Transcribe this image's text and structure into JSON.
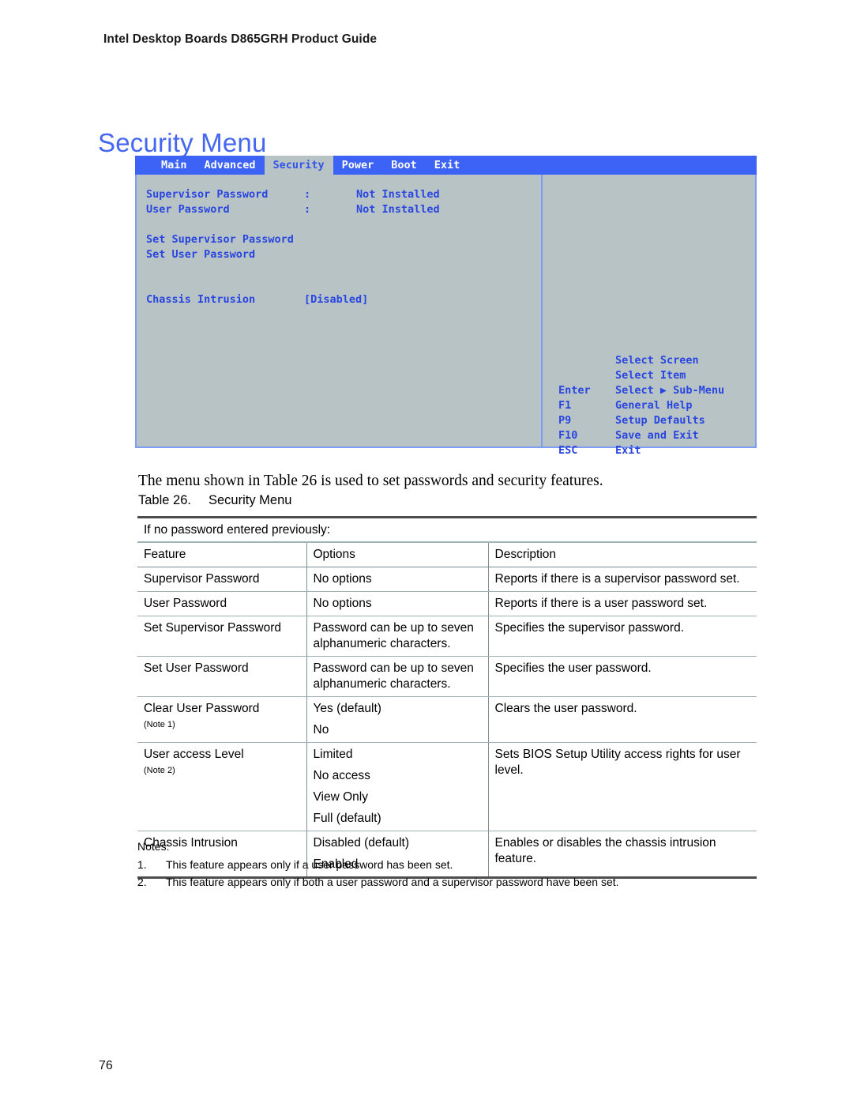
{
  "header": {
    "running_head": "Intel Desktop Boards D865GRH Product Guide"
  },
  "page_title": "Security Menu",
  "bios": {
    "tabs": [
      {
        "label": "Main",
        "active": false
      },
      {
        "label": "Advanced",
        "active": false
      },
      {
        "label": "Security",
        "active": true
      },
      {
        "label": "Power",
        "active": false
      },
      {
        "label": "Boot",
        "active": false
      },
      {
        "label": "Exit",
        "active": false
      }
    ],
    "status_rows": [
      {
        "label": "Supervisor Password",
        "colon": ":",
        "value": "Not Installed"
      },
      {
        "label": "User Password",
        "colon": ":",
        "value": "Not Installed"
      }
    ],
    "actions": [
      "Set Supervisor Password",
      "Set User Password"
    ],
    "setting": {
      "label": "Chassis Intrusion",
      "value": "[Disabled]"
    },
    "help": [
      {
        "key": "",
        "desc": "Select Screen"
      },
      {
        "key": "",
        "desc": "Select Item"
      },
      {
        "key": "Enter",
        "desc": "Select ▶ Sub-Menu"
      },
      {
        "key": "F1",
        "desc": "General Help"
      },
      {
        "key": "P9",
        "desc": "Setup Defaults"
      },
      {
        "key": "F10",
        "desc": "Save and Exit"
      },
      {
        "key": "ESC",
        "desc": "Exit"
      }
    ],
    "colors": {
      "menubar": "#3c63f5",
      "panel": "#b7c3c5",
      "text": "#2a46e0",
      "border": "#7e9cf0"
    }
  },
  "body_paragraph": "The menu shown in Table 26 is used to set passwords and security features.",
  "table_caption": {
    "number": "Table 26.",
    "title": "Security Menu"
  },
  "table": {
    "banner": "If no password entered previously:",
    "headers": [
      "Feature",
      "Options",
      "Description"
    ],
    "rows": [
      {
        "feature": "Supervisor Password",
        "note": "",
        "options": [
          "No options"
        ],
        "description": [
          "Reports if there is a supervisor password set."
        ]
      },
      {
        "feature": "User Password",
        "note": "",
        "options": [
          "No options"
        ],
        "description": [
          "Reports if there is a user password set."
        ]
      },
      {
        "feature": "Set Supervisor Password",
        "note": "",
        "options": [
          "Password can be up to seven alphanumeric characters."
        ],
        "description": [
          "Specifies the supervisor password."
        ]
      },
      {
        "feature": "Set User Password",
        "note": "",
        "options": [
          "Password can be up to seven alphanumeric characters."
        ],
        "description": [
          "Specifies the user password."
        ]
      },
      {
        "feature": "Clear User Password",
        "note": "(Note 1)",
        "options": [
          "Yes (default)",
          "No"
        ],
        "description": [
          "Clears the user password."
        ]
      },
      {
        "feature": "User access Level",
        "note": "(Note 2)",
        "options": [
          "Limited",
          "No access",
          "View Only",
          "Full (default)"
        ],
        "description": [
          "Sets BIOS Setup Utility access rights for user level."
        ]
      },
      {
        "feature": "Chassis Intrusion",
        "note": "",
        "options": [
          "Disabled (default)",
          "Enabled"
        ],
        "description": [
          "Enables or disables the chassis intrusion feature."
        ]
      }
    ]
  },
  "notes": {
    "title": "Notes:",
    "items": [
      {
        "num": "1.",
        "text": "This feature appears only if a user password has been set."
      },
      {
        "num": "2.",
        "text": "This feature appears only if both a user password and a supervisor password have been set."
      }
    ]
  },
  "page_number": "76"
}
